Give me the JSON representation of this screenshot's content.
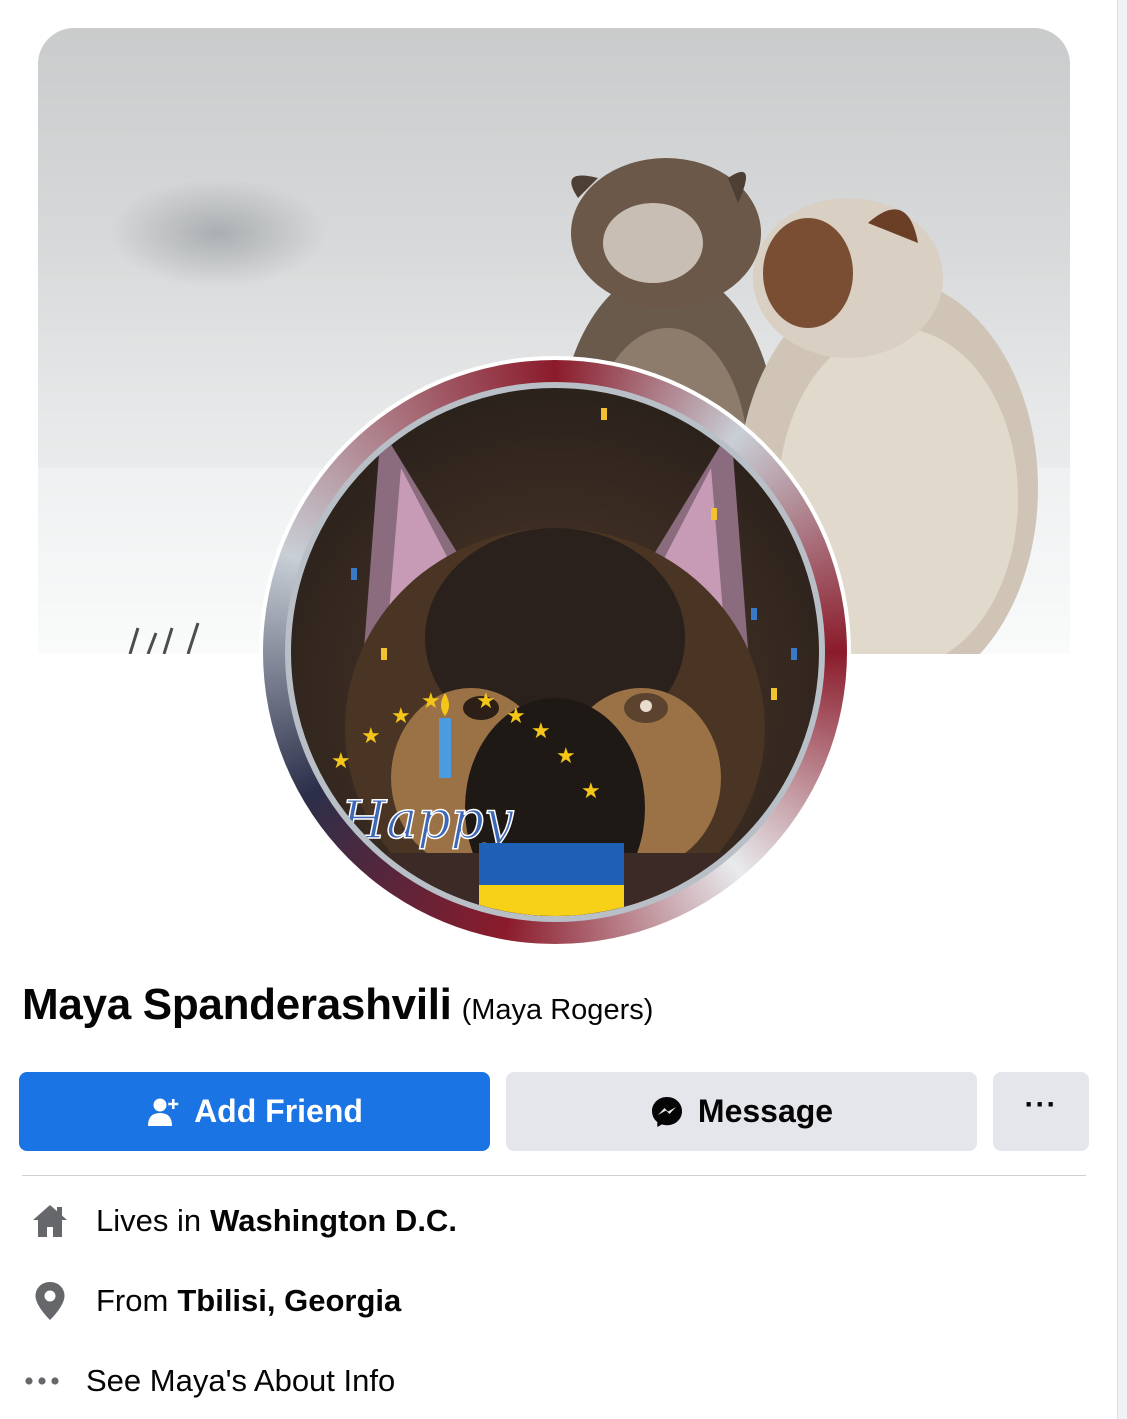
{
  "profile": {
    "name": "Maya Spanderashvili",
    "alternate_name": "(Maya Rogers)"
  },
  "actions": {
    "add_friend_label": "Add Friend",
    "message_label": "Message",
    "more_label": "···"
  },
  "intro": {
    "lives_prefix": "Lives in",
    "lives_value": "Washington D.C.",
    "from_prefix": "From",
    "from_value": "Tbilisi, Georgia",
    "about_label": "See Maya's About Info"
  },
  "avatar_badge": {
    "happy_text": "Happy"
  },
  "colors": {
    "primary": "#1b74e4",
    "secondary_button": "#e4e6eb",
    "icon_gray": "#65676b",
    "flag_blue": "#1f5fb5",
    "flag_yellow": "#f7d117"
  },
  "icons": {
    "add_friend": "person-plus-icon",
    "message": "messenger-icon",
    "more": "ellipsis-icon",
    "lives": "home-icon",
    "from": "location-pin-icon",
    "about": "ellipsis-icon"
  }
}
